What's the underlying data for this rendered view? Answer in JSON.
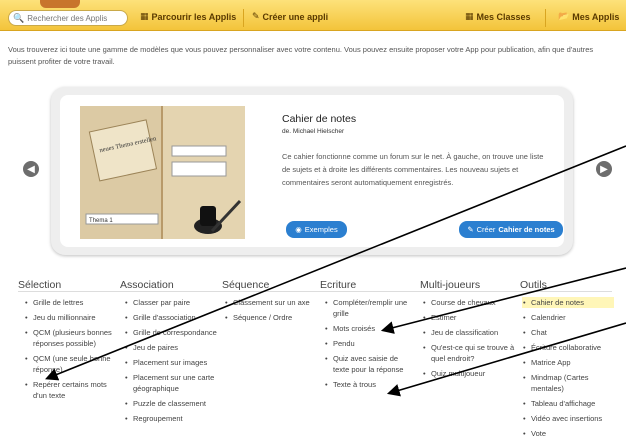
{
  "topbar": {
    "search_placeholder": "Rechercher des Applis",
    "browse_label": "Parcourir les Applis",
    "create_label": "Créer une appli",
    "classes_label": "Mes Classes",
    "apps_label": "Mes Applis"
  },
  "intro": "Vous trouverez ici toute une gamme de modèles que vous pouvez personnaliser avec votre contenu. Vous pouvez ensuite proposer votre App pour publication, afin que d'autres puissent profiter de votre travail.",
  "card": {
    "title": "Cahier de notes",
    "author": "de. Michael Hielscher",
    "description": "Ce cahier fonctionne comme un forum sur le net. À gauche, on trouve une liste de sujets et à droite les différents commentaires. Les nouveau sujets et commentaires seront automatiquement enregistrés.",
    "examples_label": "Exemples",
    "create_prefix": "Créer",
    "create_name": "Cahier de notes",
    "preview_note_text": "neues Thema erstellen",
    "preview_input_value": "Thema 1"
  },
  "columns": [
    {
      "heading": "Sélection",
      "items": [
        "Grille de lettres",
        "Jeu du millionnaire",
        "QCM (plusieurs bonnes réponses possible)",
        "QCM (une seule bonne réponse)",
        "Repérer certains mots d'un texte"
      ]
    },
    {
      "heading": "Association",
      "items": [
        "Classer par paire",
        "Grille d'association",
        "Grille de correspondance",
        "Jeu de paires",
        "Placement sur images",
        "Placement sur une carte géographique",
        "Puzzle de classement",
        "Regroupement"
      ]
    },
    {
      "heading": "Séquence",
      "items": [
        "Classement sur un axe",
        "Séquence / Ordre"
      ]
    },
    {
      "heading": "Ecriture",
      "items": [
        "Compléter/remplir une grille",
        "Mots croisés",
        "Pendu",
        "Quiz avec saisie de texte pour la réponse",
        "Texte à trous"
      ]
    },
    {
      "heading": "Multi-joueurs",
      "items": [
        "Course de chevaux",
        "Estimer",
        "Jeu de classification",
        "Qu'est-ce qui se trouve à quel endroit?",
        "Quiz multijoueur"
      ]
    },
    {
      "heading": "Outils",
      "items": [
        "Cahier de notes",
        "Calendrier",
        "Chat",
        "Écriture collaborative",
        "Matrice App",
        "Mindmap (Cartes mentales)",
        "Tableau d'affichage",
        "Vidéo avec insertions",
        "Vote"
      ]
    }
  ],
  "colors": {
    "topbar": "#f3c43a",
    "button": "#2b7fd0",
    "highlight": "#fff6b8"
  }
}
